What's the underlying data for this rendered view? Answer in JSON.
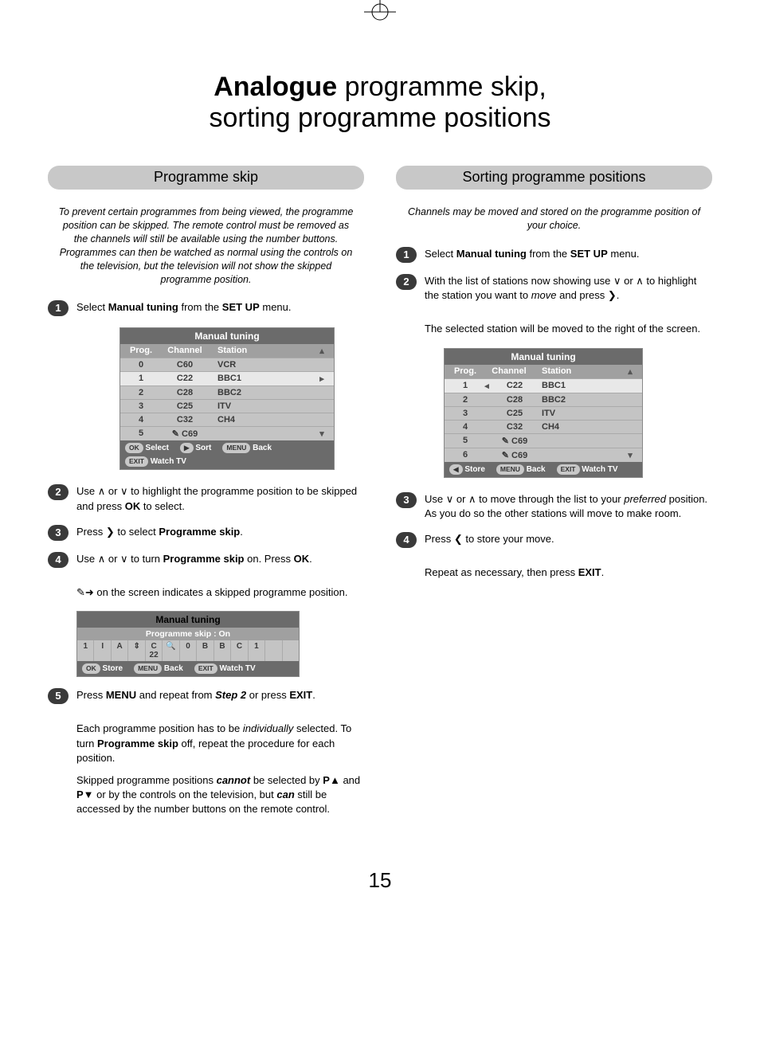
{
  "page_number": "15",
  "title": {
    "bold": "Analogue",
    "rest_line1": " programme skip,",
    "line2": "sorting programme positions"
  },
  "left": {
    "header": "Programme skip",
    "intro": "To prevent certain programmes from being viewed, the programme position can be skipped. The remote control must be removed as the channels will still be available using the number buttons. Programmes can then be watched as normal using the controls on the television, but the television will not show the skipped programme position.",
    "steps": {
      "s1": "Select <b>Manual tuning</b> from the <b>SET UP</b> menu.",
      "s2": "Use ∧ or ∨ to highlight the programme position to be skipped and press <b>OK</b> to select.",
      "s3": "Press ❯ to select <b>Programme skip</b>.",
      "s4": "Use ∧ or ∨ to turn <b>Programme skip</b> on. Press <b>OK</b>.",
      "s4b": "✎➜ on the screen indicates a skipped programme position.",
      "s5": "Press <b>MENU</b> and repeat from <b><i>Step 2</i></b> or press <b>EXIT</b>.",
      "s5b": "Each programme position has to be <i>individually</i> selected. To turn <b>Programme skip</b> off, repeat the procedure for each position.",
      "s5c": "Skipped programme positions <b><i>cannot</i></b> be selected by <b>P▲</b> and <b>P▼</b> or by the controls on the television, but <b><i>can</i></b> still be accessed by the number buttons on the remote control."
    },
    "menu1": {
      "title": "Manual tuning",
      "head": {
        "prog": "Prog.",
        "chan": "Channel",
        "stat": "Station"
      },
      "rows": [
        {
          "prog": "0",
          "chan": "C60",
          "stat": "VCR"
        },
        {
          "prog": "1",
          "chan": "C22",
          "stat": "BBC1",
          "selected": true,
          "arrow": "▸"
        },
        {
          "prog": "2",
          "chan": "C28",
          "stat": "BBC2"
        },
        {
          "prog": "3",
          "chan": "C25",
          "stat": "ITV"
        },
        {
          "prog": "4",
          "chan": "C32",
          "stat": "CH4"
        },
        {
          "prog": "5",
          "chan": "✎ C69",
          "stat": ""
        }
      ],
      "footer": [
        {
          "badge": "OK",
          "label": "Select"
        },
        {
          "badge": "▶",
          "label": "Sort"
        },
        {
          "badge": "MENU",
          "label": "Back"
        },
        {
          "badge": "EXIT",
          "label": "Watch TV"
        }
      ]
    },
    "menu2": {
      "title": "Manual tuning",
      "subtitle": "Programme skip : On",
      "cells": [
        "1",
        "I",
        "A",
        "⇕",
        "C 22",
        "🔍",
        "0",
        "B",
        "B",
        "C",
        "1",
        "",
        ""
      ],
      "footer": [
        {
          "badge": "OK",
          "label": "Store"
        },
        {
          "badge": "MENU",
          "label": "Back"
        },
        {
          "badge": "EXIT",
          "label": "Watch TV"
        }
      ]
    }
  },
  "right": {
    "header": "Sorting programme positions",
    "intro": "Channels may be moved and stored on the programme position of your choice.",
    "steps": {
      "s1": "Select <b>Manual tuning</b> from the <b>SET UP</b> menu.",
      "s2": "With the list of stations now showing use ∨ or ∧ to highlight the station you want to <i>move</i> and press ❯.",
      "s2b": "The selected station will be moved to the right of the screen.",
      "s3": "Use ∨ or ∧ to move through the list to your <i>preferred</i> position. As you do so the other stations will move to make room.",
      "s4": "Press ❮ to store your move.",
      "s4b": "Repeat as necessary, then press <b>EXIT</b>."
    },
    "menu": {
      "title": "Manual tuning",
      "head": {
        "prog": "Prog.",
        "chan": "Channel",
        "stat": "Station"
      },
      "rows": [
        {
          "prog": "1",
          "chan": "C22",
          "stat": "BBC1",
          "selected": true,
          "left_arrow": "◂"
        },
        {
          "prog": "2",
          "chan": "C28",
          "stat": "BBC2"
        },
        {
          "prog": "3",
          "chan": "C25",
          "stat": "ITV"
        },
        {
          "prog": "4",
          "chan": "C32",
          "stat": "CH4"
        },
        {
          "prog": "5",
          "chan": "✎ C69",
          "stat": ""
        },
        {
          "prog": "6",
          "chan": "✎ C69",
          "stat": ""
        }
      ],
      "footer": [
        {
          "badge": "◀",
          "label": "Store"
        },
        {
          "badge": "MENU",
          "label": "Back"
        },
        {
          "badge": "EXIT",
          "label": "Watch TV"
        }
      ]
    }
  }
}
